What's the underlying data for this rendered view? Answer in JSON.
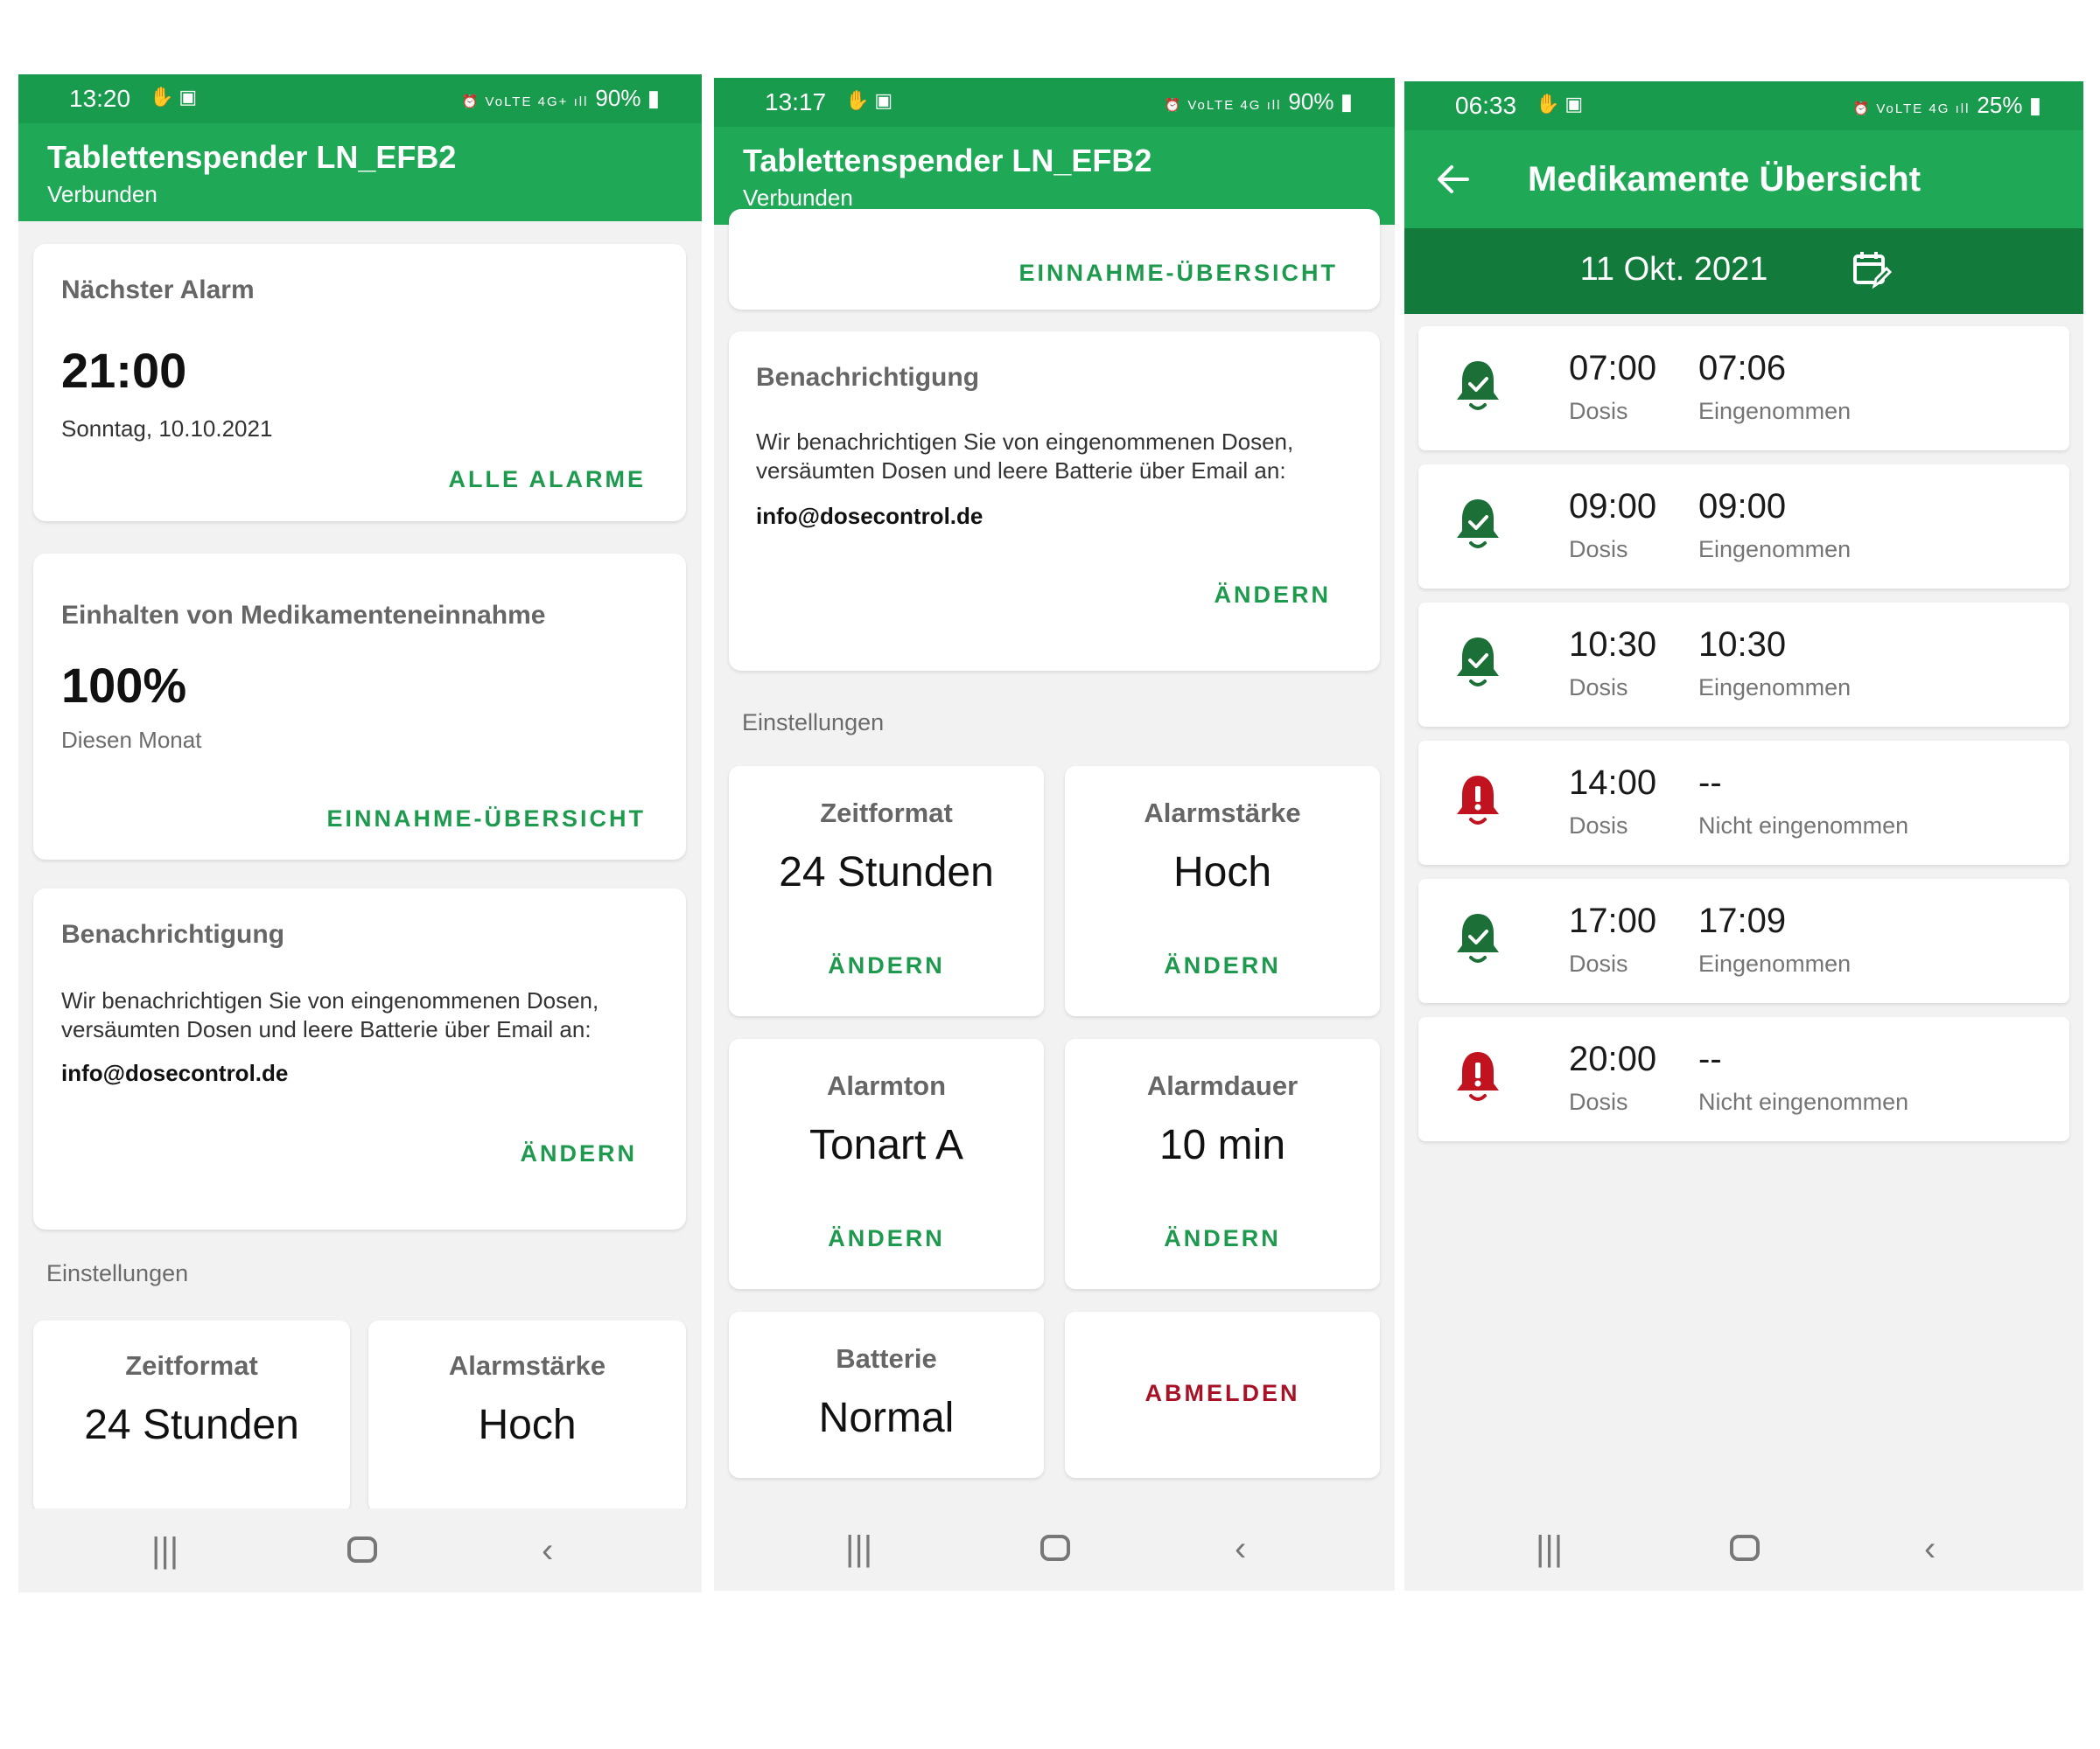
{
  "colors": {
    "primary": "#1fa957",
    "primary_dark": "#127a3b",
    "accent_green": "#1e9a4e",
    "danger_red": "#a81226",
    "taken_bell": "#1b6f37",
    "missed_bell": "#c1121f"
  },
  "phone1": {
    "status": {
      "time": "13:20",
      "battery": "90%"
    },
    "appbar": {
      "title": "Tablettenspender LN_EFB2",
      "subtitle": "Verbunden"
    },
    "next_alarm": {
      "title": "Nächster Alarm",
      "time": "21:00",
      "date": "Sonntag, 10.10.2021",
      "action": "ALLE ALARME"
    },
    "adherence": {
      "title": "Einhalten von Medikamenteneinnahme",
      "value": "100%",
      "period": "Diesen Monat",
      "action": "EINNAHME-ÜBERSICHT"
    },
    "notification": {
      "title": "Benachrichtigung",
      "text_line1": "Wir benachrichtigen Sie von eingenommenen Dosen,",
      "text_line2": "versäumten Dosen und leere Batterie über Email an:",
      "email": "info@dosecontrol.de",
      "action": "ÄNDERN"
    },
    "settings_label": "Einstellungen",
    "tiles": [
      {
        "label": "Zeitformat",
        "value": "24 Stunden"
      },
      {
        "label": "Alarmstärke",
        "value": "Hoch"
      }
    ]
  },
  "phone2": {
    "status": {
      "time": "13:17",
      "battery": "90%"
    },
    "appbar": {
      "title": "Tablettenspender LN_EFB2",
      "subtitle": "Verbunden"
    },
    "top_action": "EINNAHME-ÜBERSICHT",
    "notification": {
      "title": "Benachrichtigung",
      "text_line1": "Wir benachrichtigen Sie von eingenommenen Dosen,",
      "text_line2": "versäumten Dosen und leere Batterie über Email an:",
      "email": "info@dosecontrol.de",
      "action": "ÄNDERN"
    },
    "settings_label": "Einstellungen",
    "tiles": [
      {
        "label": "Zeitformat",
        "value": "24 Stunden",
        "action": "ÄNDERN"
      },
      {
        "label": "Alarmstärke",
        "value": "Hoch",
        "action": "ÄNDERN"
      },
      {
        "label": "Alarmton",
        "value": "Tonart A",
        "action": "ÄNDERN"
      },
      {
        "label": "Alarmdauer",
        "value": "10 min",
        "action": "ÄNDERN"
      },
      {
        "label": "Batterie",
        "value": "Normal"
      }
    ],
    "logout": "ABMELDEN"
  },
  "phone3": {
    "status": {
      "time": "06:33",
      "battery": "25%"
    },
    "appbar": {
      "title": "Medikamente Übersicht"
    },
    "date": "11 Okt. 2021",
    "doses": [
      {
        "planned": "07:00",
        "dose_label": "Dosis",
        "taken": "07:06",
        "state": "Eingenommen",
        "status": "taken"
      },
      {
        "planned": "09:00",
        "dose_label": "Dosis",
        "taken": "09:00",
        "state": "Eingenommen",
        "status": "taken"
      },
      {
        "planned": "10:30",
        "dose_label": "Dosis",
        "taken": "10:30",
        "state": "Eingenommen",
        "status": "taken"
      },
      {
        "planned": "14:00",
        "dose_label": "Dosis",
        "taken": "--",
        "state": "Nicht eingenommen",
        "status": "missed"
      },
      {
        "planned": "17:00",
        "dose_label": "Dosis",
        "taken": "17:09",
        "state": "Eingenommen",
        "status": "taken"
      },
      {
        "planned": "20:00",
        "dose_label": "Dosis",
        "taken": "--",
        "state": "Nicht eingenommen",
        "status": "missed"
      }
    ]
  }
}
